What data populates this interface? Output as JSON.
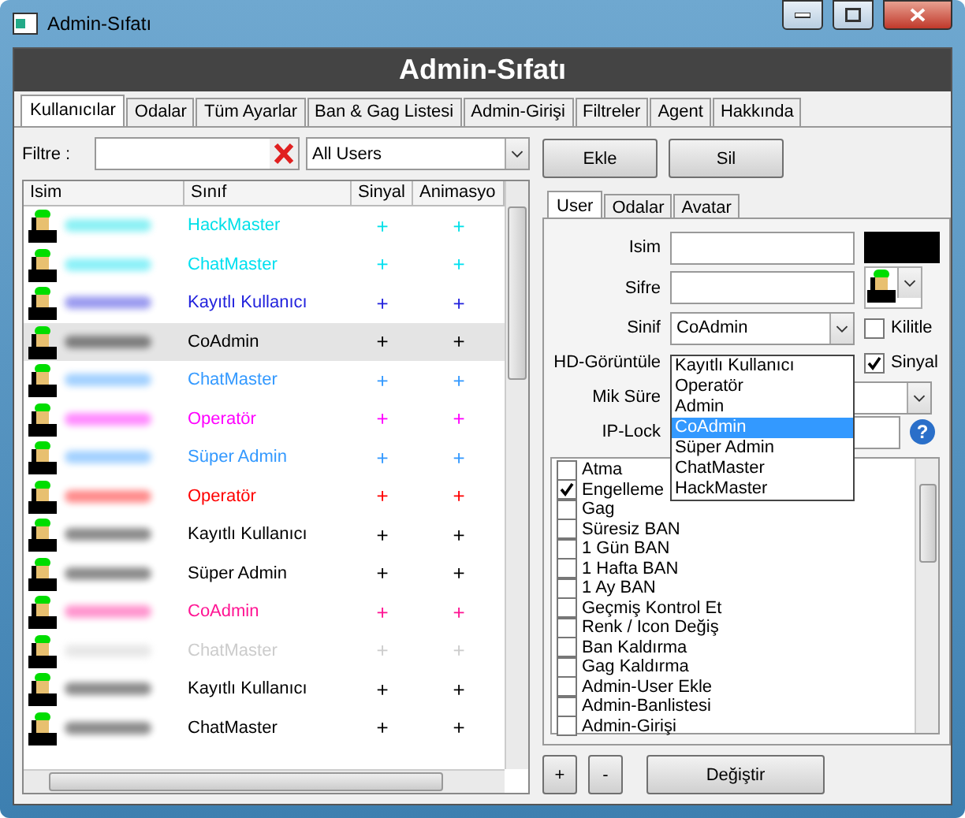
{
  "window": {
    "title": "Admin-Sıfatı"
  },
  "header": "Admin-Sıfatı",
  "tabs": [
    {
      "label": "Kullanıcılar",
      "selected": true
    },
    {
      "label": "Odalar",
      "selected": false
    },
    {
      "label": "Tüm Ayarlar",
      "selected": false
    },
    {
      "label": "Ban & Gag Listesi",
      "selected": false
    },
    {
      "label": "Admin-Girişi",
      "selected": false
    },
    {
      "label": "Filtreler",
      "selected": false
    },
    {
      "label": "Agent",
      "selected": false
    },
    {
      "label": "Hakkında",
      "selected": false
    }
  ],
  "filter": {
    "label": "Filtre :",
    "scope": "All Users"
  },
  "actions": [
    "Ekle",
    "Sil"
  ],
  "table": {
    "columns": [
      "Isim",
      "Sınıf",
      "Sinyal",
      "Animasyo"
    ],
    "rows": [
      {
        "class": "HackMaster",
        "color": "#00e0e8",
        "selected": false,
        "signal": "+",
        "animation": "+"
      },
      {
        "class": "ChatMaster",
        "color": "#00e0f0",
        "selected": false,
        "signal": "+",
        "animation": "+"
      },
      {
        "class": "Kayıtlı Kullanıcı",
        "color": "#2222dd",
        "selected": false,
        "signal": "+",
        "animation": "+"
      },
      {
        "class": "CoAdmin",
        "color": "#000000",
        "selected": true,
        "signal": "+",
        "animation": "+"
      },
      {
        "class": "ChatMaster",
        "color": "#3399ff",
        "selected": false,
        "signal": "+",
        "animation": "+"
      },
      {
        "class": "Operatör",
        "color": "#ff00ff",
        "selected": false,
        "signal": "+",
        "animation": "+"
      },
      {
        "class": "Süper Admin",
        "color": "#3399ff",
        "selected": false,
        "signal": "+",
        "animation": "+"
      },
      {
        "class": "Operatör",
        "color": "#ff0000",
        "selected": false,
        "signal": "+",
        "animation": "+"
      },
      {
        "class": "Kayıtlı Kullanıcı",
        "color": "#000000",
        "selected": false,
        "signal": "+",
        "animation": "+"
      },
      {
        "class": "Süper Admin",
        "color": "#000000",
        "selected": false,
        "signal": "+",
        "animation": "+"
      },
      {
        "class": "CoAdmin",
        "color": "#ff1493",
        "selected": false,
        "signal": "+",
        "animation": "+"
      },
      {
        "class": "ChatMaster",
        "color": "#cccccc",
        "selected": false,
        "signal": "+",
        "animation": "+"
      },
      {
        "class": "Kayıtlı Kullanıcı",
        "color": "#000000",
        "selected": false,
        "signal": "+",
        "animation": "+"
      },
      {
        "class": "ChatMaster",
        "color": "#000000",
        "selected": false,
        "signal": "+",
        "animation": "+"
      }
    ]
  },
  "detail_tabs": [
    {
      "label": "User",
      "selected": true
    },
    {
      "label": "Odalar",
      "selected": false
    },
    {
      "label": "Avatar",
      "selected": false
    }
  ],
  "form": {
    "name_label": "Isim",
    "password_label": "Sifre",
    "class_label": "Sinif",
    "class_value": "CoAdmin",
    "hd_label": "HD-Görüntüle",
    "mic_label": "Mik Süre",
    "iplock_label": "IP-Lock",
    "lock": {
      "label": "Kilitle",
      "checked": false
    },
    "signal": {
      "label": "Sinyal",
      "checked": true
    },
    "class_options": [
      {
        "label": "Kayıtlı Kullanıcı",
        "selected": false
      },
      {
        "label": "Operatör",
        "selected": false
      },
      {
        "label": "Admin",
        "selected": false
      },
      {
        "label": "CoAdmin",
        "selected": true
      },
      {
        "label": "Süper Admin",
        "selected": false
      },
      {
        "label": "ChatMaster",
        "selected": false
      },
      {
        "label": "HackMaster",
        "selected": false
      }
    ]
  },
  "permissions": [
    {
      "label": "Atma",
      "checked": false
    },
    {
      "label": "Engelleme",
      "checked": true
    },
    {
      "label": "Gag",
      "checked": false
    },
    {
      "label": "Süresiz BAN",
      "checked": false
    },
    {
      "label": "1 Gün BAN",
      "checked": false
    },
    {
      "label": "1 Hafta BAN",
      "checked": false
    },
    {
      "label": "1 Ay BAN",
      "checked": false
    },
    {
      "label": "Geçmiş Kontrol Et",
      "checked": false
    },
    {
      "label": "Renk / Icon Değiş",
      "checked": false
    },
    {
      "label": "Ban Kaldırma",
      "checked": false
    },
    {
      "label": "Gag Kaldırma",
      "checked": false
    },
    {
      "label": "Admin-User Ekle",
      "checked": false
    },
    {
      "label": "Admin-Banlistesi",
      "checked": false
    },
    {
      "label": "Admin-Girişi",
      "checked": false
    }
  ],
  "help_button": "?",
  "bottom_buttons": [
    "+",
    "-",
    "Değiştir"
  ]
}
